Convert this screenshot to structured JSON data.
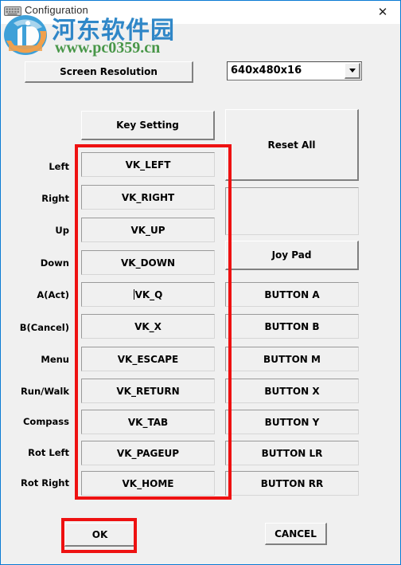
{
  "window": {
    "title": "Configuration",
    "icon": "keyboard-icon",
    "close_label": "✕",
    "border_color": "#0a7bd4",
    "background": "#f0f0f0"
  },
  "watermark": {
    "logo": "pc0359-logo",
    "site_name_cn": "河东软件园",
    "site_url": "www.pc0359.cn",
    "cn_color": "#1f7ec4",
    "url_color": "#3a8f3a"
  },
  "toolbar": {
    "screen_resolution_label": "Screen Resolution",
    "resolution_value": "640x480x16",
    "resolution_options": [
      "640x480x16"
    ],
    "dropdown_icon": "chevron-down-icon"
  },
  "headers": {
    "key_setting_label": "Key Setting",
    "reset_all_label": "Reset All",
    "joy_pad_label": "Joy Pad",
    "blank_panel_label": ""
  },
  "bindings": {
    "rows": [
      {
        "action": "Left",
        "key": "VK_LEFT",
        "pad": ""
      },
      {
        "action": "Right",
        "key": "VK_RIGHT",
        "pad": ""
      },
      {
        "action": "Up",
        "key": "VK_UP",
        "pad": ""
      },
      {
        "action": "Down",
        "key": "VK_DOWN",
        "pad": ""
      },
      {
        "action": "A(Act)",
        "key": "VK_Q",
        "pad": "BUTTON A"
      },
      {
        "action": "B(Cancel)",
        "key": "VK_X",
        "pad": "BUTTON B"
      },
      {
        "action": "Menu",
        "key": "VK_ESCAPE",
        "pad": "BUTTON M"
      },
      {
        "action": "Run/Walk",
        "key": "VK_RETURN",
        "pad": "BUTTON X"
      },
      {
        "action": "Compass",
        "key": "VK_TAB",
        "pad": "BUTTON Y"
      },
      {
        "action": "Rot Left",
        "key": "VK_PAGEUP",
        "pad": "BUTTON LR"
      },
      {
        "action": "Rot Right",
        "key": "VK_HOME",
        "pad": "BUTTON RR"
      }
    ]
  },
  "footer": {
    "ok_label": "OK",
    "cancel_label": "CANCEL"
  },
  "annotations": {
    "color": "#ee1111",
    "boxes": [
      {
        "name": "key-column-highlight"
      },
      {
        "name": "ok-button-highlight"
      }
    ]
  }
}
